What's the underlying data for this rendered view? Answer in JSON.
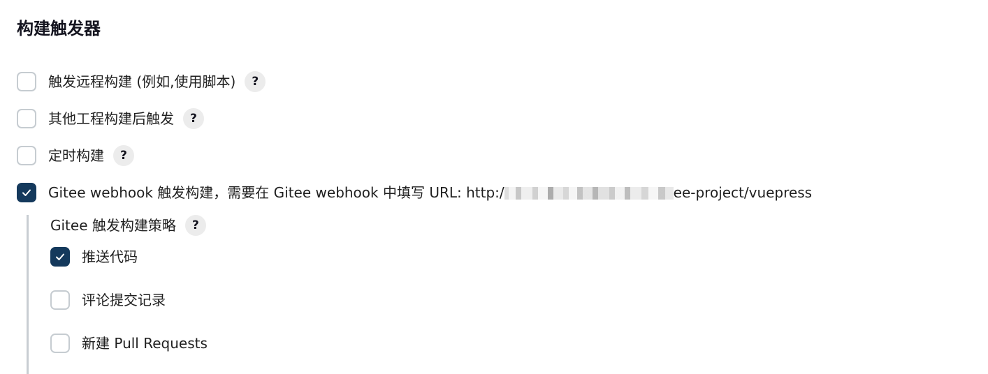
{
  "section": {
    "title": "构建触发器"
  },
  "triggers": [
    {
      "label": "触发远程构建 (例如,使用脚本)",
      "checked": false,
      "help": "?"
    },
    {
      "label": "其他工程构建后触发",
      "checked": false,
      "help": "?"
    },
    {
      "label": "定时构建",
      "checked": false,
      "help": "?"
    },
    {
      "label_prefix": "Gitee webhook 触发构建，需要在 Gitee webhook 中填写 URL: http:/",
      "label_suffix": "ee-project/vuepress",
      "checked": true
    }
  ],
  "gitee_strategy": {
    "title": "Gitee 触发构建策略",
    "help": "?",
    "options": [
      {
        "label": "推送代码",
        "checked": true
      },
      {
        "label": "评论提交记录",
        "checked": false
      },
      {
        "label": "新建 Pull Requests",
        "checked": false
      }
    ]
  },
  "colors": {
    "checked_fill": "#14395c",
    "unchecked_border": "#c6ccd1",
    "help_bg": "#ececec",
    "sub_bar": "#c8cdd2"
  },
  "icons": {
    "checkmark": "checkmark-icon",
    "help": "help-icon"
  }
}
